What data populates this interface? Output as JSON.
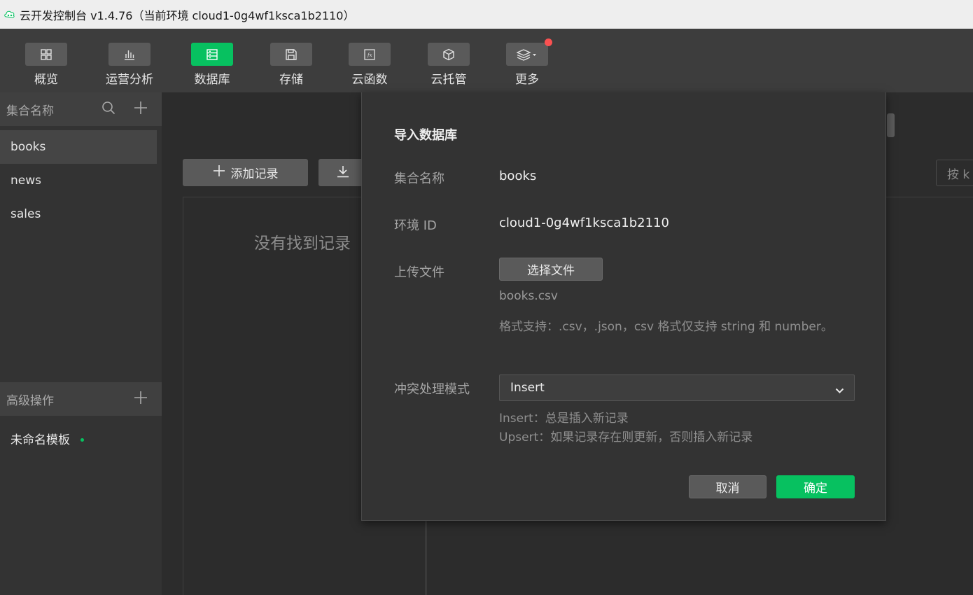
{
  "window": {
    "title": "云开发控制台 v1.4.76（当前环境 cloud1-0g4wf1ksca1b2110）"
  },
  "toolbar": {
    "items": [
      {
        "label": "概览",
        "icon": "grid-icon"
      },
      {
        "label": "运营分析",
        "icon": "bar-chart-icon"
      },
      {
        "label": "数据库",
        "icon": "database-icon"
      },
      {
        "label": "存储",
        "icon": "floppy-disk-icon"
      },
      {
        "label": "云函数",
        "icon": "function-icon"
      },
      {
        "label": "云托管",
        "icon": "cube-icon"
      },
      {
        "label": "更多",
        "icon": "layers-icon"
      }
    ],
    "active_index": 2,
    "accent": "#07c160",
    "notification_color": "#fa5151"
  },
  "sidebar": {
    "collections_header": "集合名称",
    "collections": [
      "books",
      "news",
      "sales"
    ],
    "selected_collection": "books",
    "advanced_header": "高级操作",
    "template_name": "未命名模板"
  },
  "main": {
    "add_record_label": "添加记录",
    "search_placeholder": "按 k",
    "empty_text": "没有找到记录"
  },
  "dialog": {
    "title": "导入数据库",
    "collection_label": "集合名称",
    "collection_value": "books",
    "env_label": "环境 ID",
    "env_value": "cloud1-0g4wf1ksca1b2110",
    "upload_label": "上传文件",
    "choose_file_label": "选择文件",
    "file_name": "books.csv",
    "format_hint": "格式支持：.csv，.json，csv 格式仅支持 string 和 number。",
    "conflict_label": "冲突处理模式",
    "conflict_value": "Insert",
    "insert_hint": "Insert：总是插入新记录",
    "upsert_hint": "Upsert：如果记录存在则更新，否则插入新记录",
    "cancel_label": "取消",
    "confirm_label": "确定"
  }
}
